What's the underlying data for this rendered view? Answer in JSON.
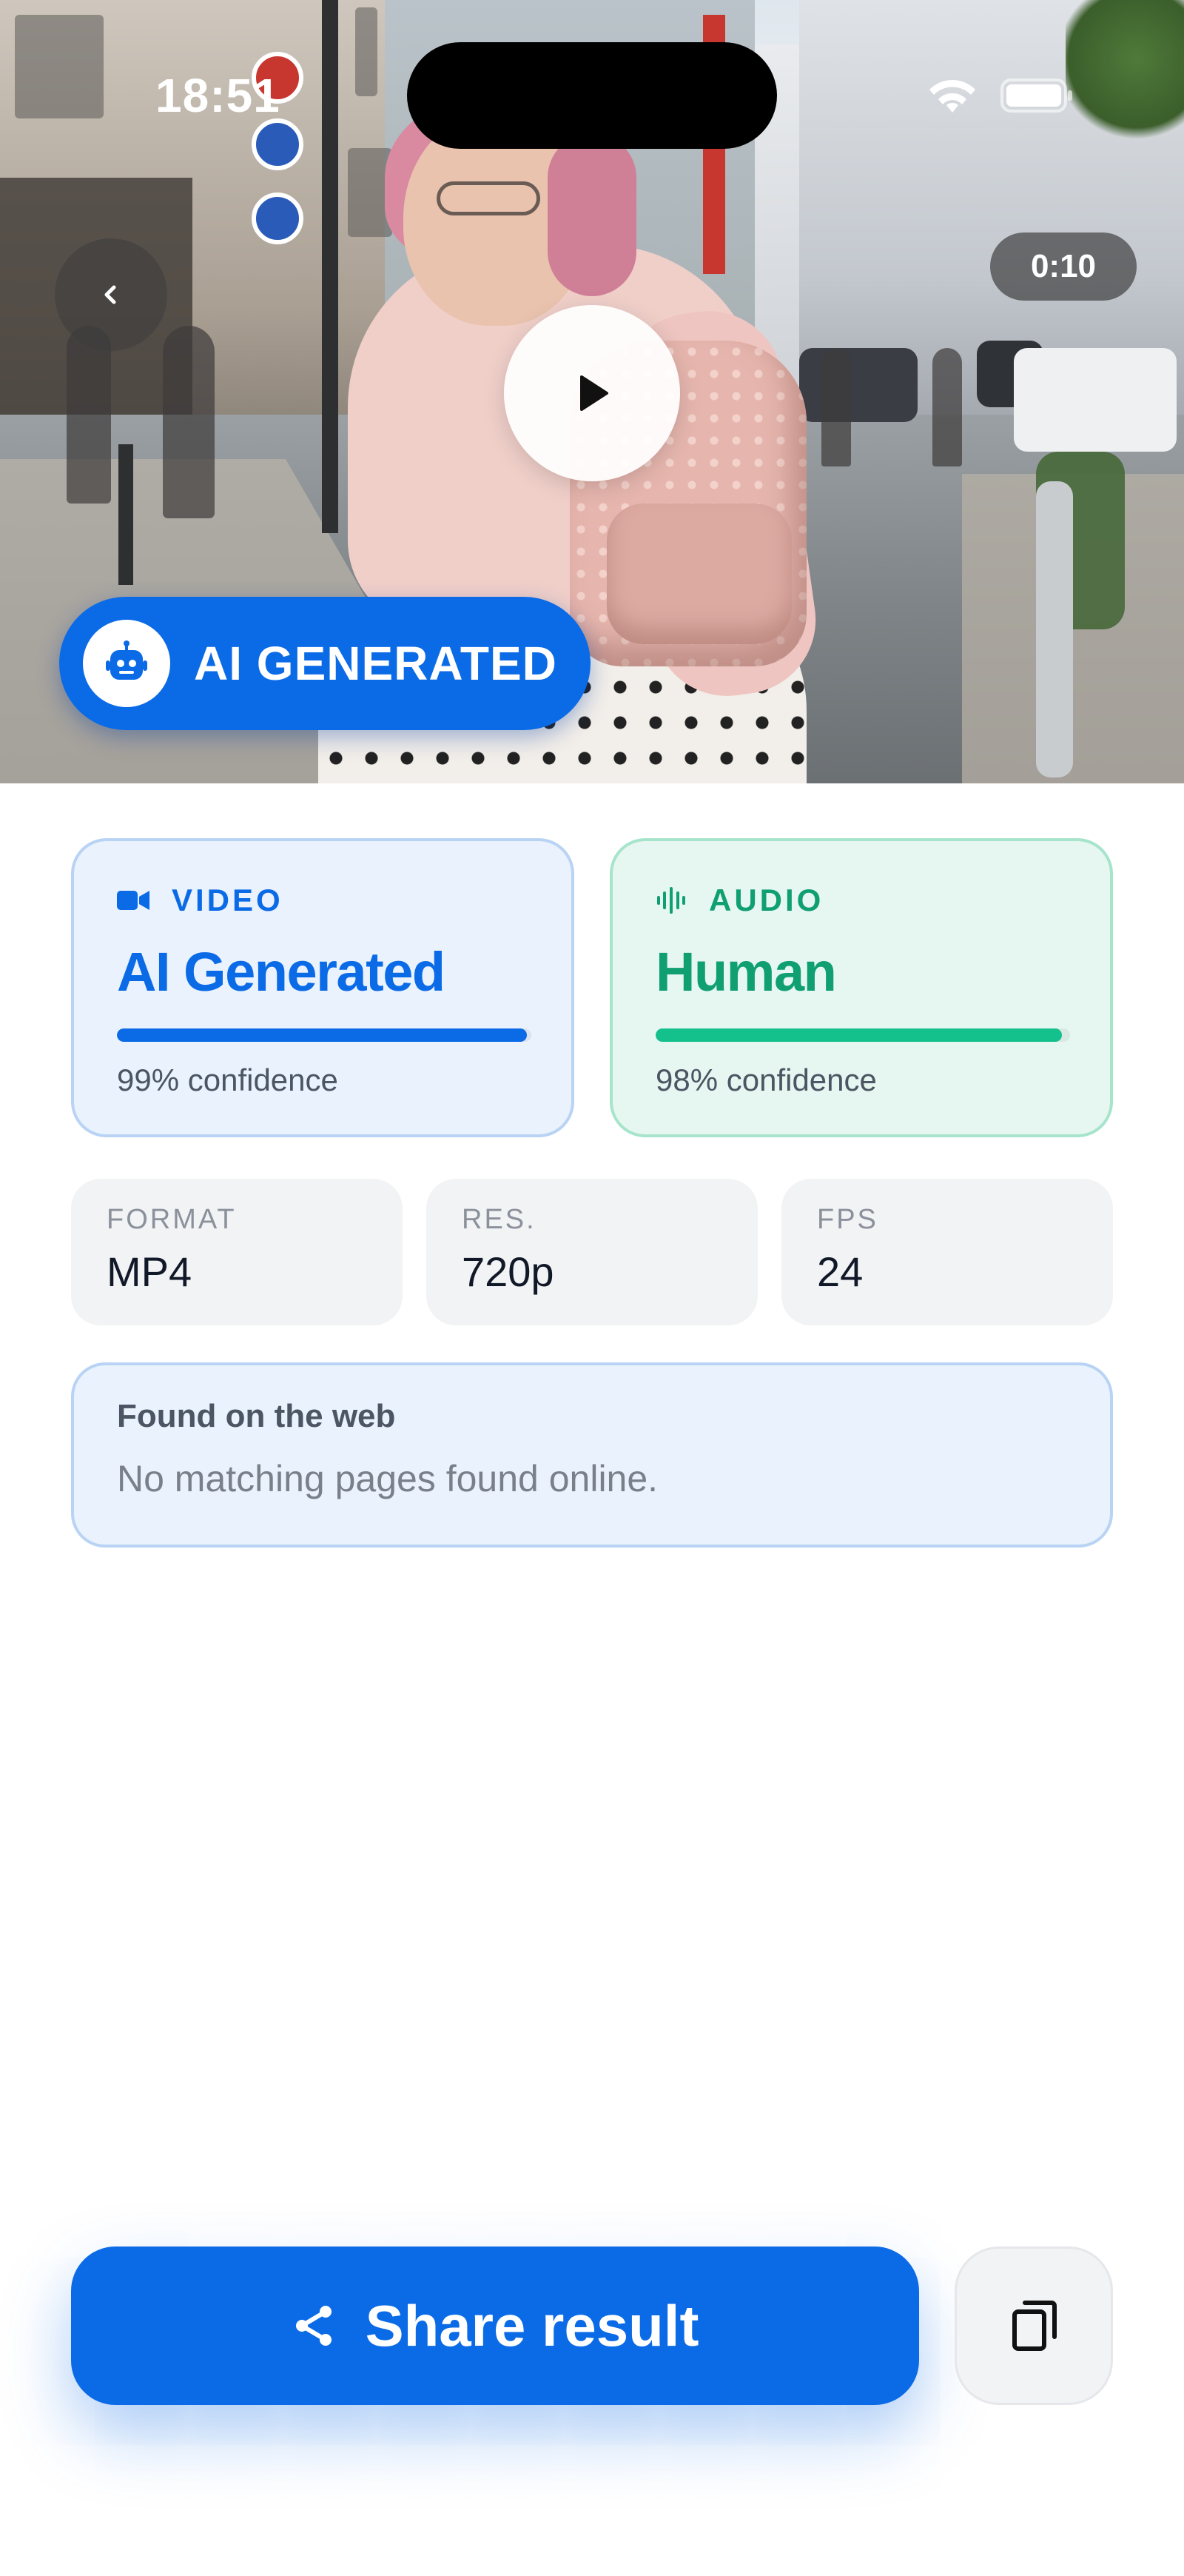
{
  "status_bar": {
    "time": "18:51"
  },
  "player": {
    "duration": "0:10",
    "verdict_badge": "AI GENERATED"
  },
  "results": {
    "video": {
      "kind": "VIDEO",
      "verdict": "AI Generated",
      "confidence_label": "99% confidence",
      "confidence": 0.99
    },
    "audio": {
      "kind": "AUDIO",
      "verdict": "Human",
      "confidence_label": "98% confidence",
      "confidence": 0.98
    }
  },
  "meta": [
    {
      "key": "FORMAT",
      "value": "MP4"
    },
    {
      "key": "RES.",
      "value": "720p"
    },
    {
      "key": "FPS",
      "value": "24"
    }
  ],
  "web_search": {
    "heading": "Found on the web",
    "body": "No matching pages found online."
  },
  "actions": {
    "share_label": "Share result"
  },
  "colors": {
    "accent_blue": "#0b6be6",
    "accent_green": "#0f9f71"
  },
  "icons": [
    "back-chevron-icon",
    "play-icon",
    "robot-icon",
    "video-camera-icon",
    "audio-waveform-icon",
    "share-icon",
    "copy-icon",
    "wifi-icon",
    "battery-icon"
  ]
}
